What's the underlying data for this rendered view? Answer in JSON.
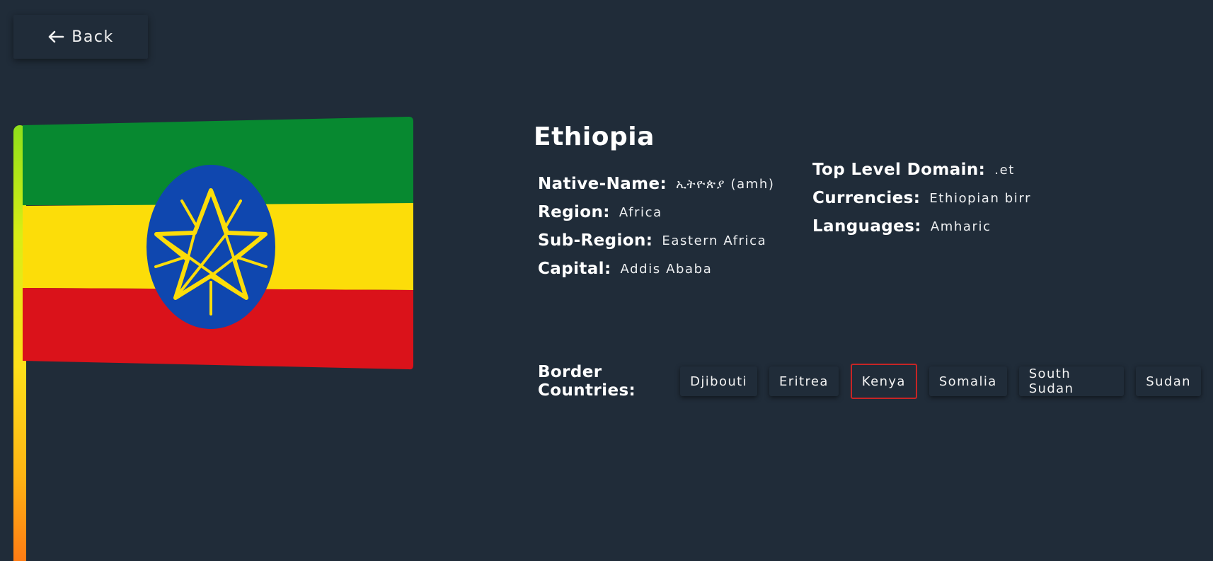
{
  "back_button": {
    "label": "Back",
    "icon": "arrow-left-icon"
  },
  "flag": {
    "alt": "Flag of Ethiopia",
    "stripe_colors": [
      "#078930",
      "#fcdd09",
      "#da121a"
    ],
    "emblem_color": "#0f47af",
    "star_color": "#fcdd09"
  },
  "pole": {
    "gradient": [
      "#8fe01a",
      "#ffe01a",
      "#ff7a14"
    ]
  },
  "country": {
    "name": "Ethiopia",
    "native_name_label": "Native-Name:",
    "native_name": "ኢትዮጵያ (amh)",
    "region_label": "Region:",
    "region": "Africa",
    "subregion_label": "Sub-Region:",
    "subregion": "Eastern Africa",
    "capital_label": "Capital:",
    "capital": "Addis Ababa",
    "tld_label": "Top Level Domain:",
    "tld": ".et",
    "currencies_label": "Currencies:",
    "currencies": "Ethiopian birr",
    "languages_label": "Languages:",
    "languages": "Amharic"
  },
  "borders": {
    "label": "Border Countries:",
    "countries": [
      {
        "name": "Djibouti",
        "selected": false
      },
      {
        "name": "Eritrea",
        "selected": false
      },
      {
        "name": "Kenya",
        "selected": true
      },
      {
        "name": "Somalia",
        "selected": false
      },
      {
        "name": "South Sudan",
        "selected": false
      },
      {
        "name": "Sudan",
        "selected": false
      }
    ]
  },
  "colors": {
    "background": "#202c39",
    "text": "#ffffff",
    "selected_border": "#c72525"
  }
}
